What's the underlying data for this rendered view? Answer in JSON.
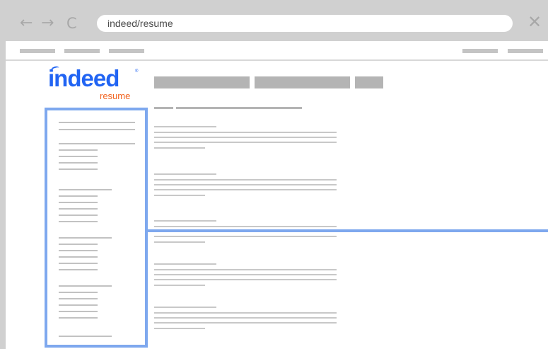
{
  "browser": {
    "url": "indeed/resume",
    "icons": {
      "back": "arrow-left-icon",
      "forward": "arrow-right-icon",
      "reload": "reload-icon",
      "close": "close-icon"
    },
    "glyphs": {
      "back": "←",
      "forward": "→",
      "reload": "C",
      "close": "✕"
    }
  },
  "logo": {
    "main": "indeed",
    "sub": "resume",
    "reg": "®"
  },
  "colors": {
    "chrome": "#d0d0d0",
    "brand_blue": "#2164f3",
    "brand_orange": "#f26522",
    "highlight": "#7ea8ee",
    "placeholder": "#c4c4c4"
  }
}
